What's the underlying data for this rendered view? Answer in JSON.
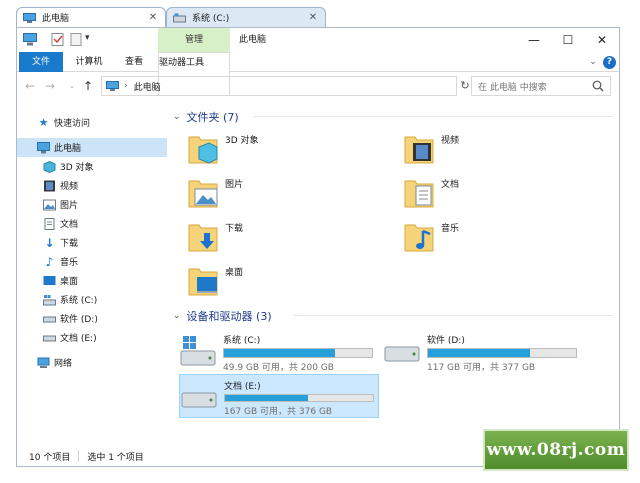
{
  "tabs": [
    {
      "label": "此电脑",
      "active": true
    },
    {
      "label": "系统 (C:)",
      "active": false
    }
  ],
  "window": {
    "manage_tab": "管理",
    "title": "此电脑",
    "ribbon": {
      "file": "文件",
      "computer": "计算机",
      "view": "查看",
      "drive_tools": "驱动器工具"
    },
    "minimize": "—",
    "maximize": "☐",
    "close": "✕"
  },
  "address": {
    "path": "此电脑",
    "search_placeholder": "在 此电脑 中搜索"
  },
  "nav": {
    "quick_access": "快速访问",
    "this_pc": "此电脑",
    "items": [
      "3D 对象",
      "视频",
      "图片",
      "文档",
      "下载",
      "音乐",
      "桌面",
      "系统 (C:)",
      "软件 (D:)",
      "文档 (E:)"
    ],
    "network": "网络"
  },
  "folders_group": {
    "title": "文件夹 (7)",
    "items": [
      "3D 对象",
      "视频",
      "图片",
      "文档",
      "下载",
      "音乐",
      "桌面"
    ]
  },
  "drives_group": {
    "title": "设备和驱动器 (3)",
    "items": [
      {
        "name": "系统 (C:)",
        "size": "49.9 GB 可用，共 200 GB",
        "used_fraction": 0.75
      },
      {
        "name": "软件 (D:)",
        "size": "117 GB 可用，共 377 GB",
        "used_fraction": 0.69
      },
      {
        "name": "文档 (E:)",
        "size": "167 GB 可用，共 376 GB",
        "used_fraction": 0.56
      }
    ]
  },
  "status": {
    "count": "10 个项目",
    "selected": "选中 1 个项目"
  },
  "watermark": "www.08rj.com",
  "colors": {
    "accent": "#1979ca",
    "selection": "#cce4f7",
    "bar_fill": "#26a0da",
    "manage_tab": "#d8f0c7"
  }
}
